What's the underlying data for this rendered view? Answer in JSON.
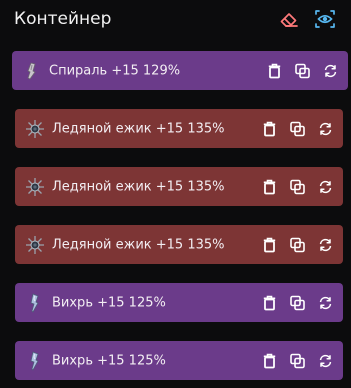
{
  "header": {
    "title": "Контейнер",
    "eraser_icon": "eraser-icon",
    "eye_icon": "eye-icon"
  },
  "colors": {
    "purple": "#6b3b8a",
    "red": "#7d3535",
    "eraser": "#ff7a7a",
    "eye": "#57b8f0"
  },
  "items": [
    {
      "label": "Спираль +15 129%",
      "color": "purple",
      "thumb": "spiral"
    },
    {
      "label": "Ледяной ежик +15 135%",
      "color": "red",
      "thumb": "hedgehog"
    },
    {
      "label": "Ледяной ежик +15 135%",
      "color": "red",
      "thumb": "hedgehog"
    },
    {
      "label": "Ледяной ежик +15 135%",
      "color": "red",
      "thumb": "hedgehog"
    },
    {
      "label": "Вихрь +15 125%",
      "color": "purple",
      "thumb": "whirl"
    },
    {
      "label": "Вихрь +15 125%",
      "color": "purple",
      "thumb": "whirl"
    }
  ]
}
